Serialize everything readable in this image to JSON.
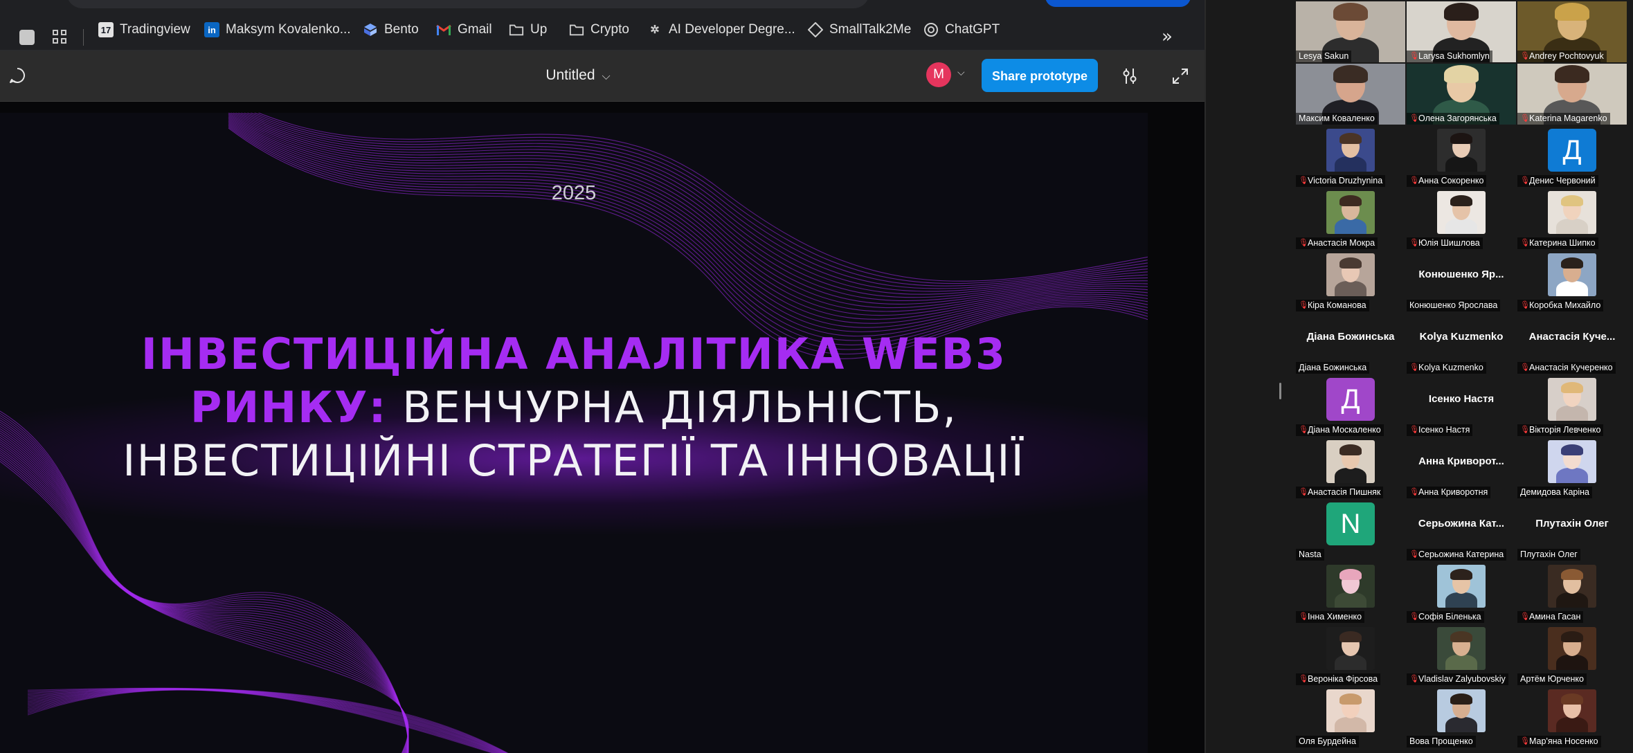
{
  "browser": {
    "bookmarks": [
      {
        "label": "Tradingview",
        "icon": "tradingview-icon"
      },
      {
        "label": "Maksym Kovalenko...",
        "icon": "linkedin-icon"
      },
      {
        "label": "Bento",
        "icon": "bento-icon"
      },
      {
        "label": "Gmail",
        "icon": "gmail-icon"
      },
      {
        "label": "Up",
        "icon": "folder-icon"
      },
      {
        "label": "Crypto",
        "icon": "folder-icon"
      },
      {
        "label": "AI Developer Degre...",
        "icon": "ai-developer-icon"
      },
      {
        "label": "SmallTalk2Me",
        "icon": "smalltalk-icon"
      },
      {
        "label": "ChatGPT",
        "icon": "chatgpt-icon"
      }
    ],
    "more_label": "»"
  },
  "figma": {
    "file_title": "Untitled",
    "avatar_initial": "M",
    "share_label": "Share prototype"
  },
  "slide": {
    "year": "2025",
    "title_highlight": "ІНВЕСТИЦІЙНА АНАЛІТИКА WEB3 РИНКУ:",
    "title_rest": " ВЕНЧУРНА ДІЯЛЬНІСТЬ, ІНВЕСТИЦІЙНІ СТРАТЕГІЇ ТА ІННОВАЦІЇ",
    "accent_color": "#a52cf2"
  },
  "gallery": {
    "participants": [
      {
        "name": "Lesya Sakun",
        "kind": "video",
        "muted": false,
        "bg": "#b9b2a8",
        "skin": "#d9b49a",
        "hair": "#6b4a36",
        "shirt": "#2d2d2d"
      },
      {
        "name": "Larysa Sukhomlyn",
        "kind": "video",
        "muted": true,
        "bg": "#d8d4cc",
        "skin": "#e0b9a0",
        "hair": "#2a1f1a",
        "shirt": "#222222"
      },
      {
        "name": "Andrey Pochtovyuk",
        "kind": "video",
        "muted": true,
        "bg": "#6d5a2a",
        "skin": "#d8b37a",
        "hair": "#caa24a",
        "shirt": "#3a2e14"
      },
      {
        "name": "Максим Коваленко",
        "kind": "video",
        "muted": false,
        "active": true,
        "bg": "#8c8f96",
        "skin": "#d6a58c",
        "hair": "#3a2c24",
        "shirt": "#1f1f25"
      },
      {
        "name": "Олена Загорянська",
        "kind": "video",
        "muted": true,
        "bg": "#18332e",
        "skin": "#e8c9a6",
        "hair": "#e3d3a4",
        "shirt": "#2f5a48"
      },
      {
        "name": "Katerina Magarenko",
        "kind": "video",
        "muted": true,
        "bg": "#cfc9bd",
        "skin": "#d7a98d",
        "hair": "#3b2a20",
        "shirt": "#585858"
      },
      {
        "name": "Victoria Druzhynina",
        "kind": "photo",
        "muted": true,
        "bg": "#3b4a8c",
        "skin": "#e4c0a3",
        "hair": "#4a3426",
        "shirt": "#24305e"
      },
      {
        "name": "Анна Сокоренко",
        "kind": "photo",
        "muted": true,
        "bg": "#2d2d2d",
        "skin": "#e8cbb5",
        "hair": "#1c1412",
        "shirt": "#161616"
      },
      {
        "name": "Денис Червоний",
        "kind": "letter",
        "muted": true,
        "letter": "Д",
        "color": "#0f7bd4"
      },
      {
        "name": "Анастасія Мокра",
        "kind": "photo",
        "muted": true,
        "bg": "#6c8d4e",
        "skin": "#d9b79c",
        "hair": "#3d2a20",
        "shirt": "#3a6aa6"
      },
      {
        "name": "Юлія Шишлова",
        "kind": "photo",
        "muted": true,
        "bg": "#ece7e2",
        "skin": "#e5c3a8",
        "hair": "#2b211b",
        "shirt": "#e6e6e6"
      },
      {
        "name": "Катерина Шипко",
        "kind": "photo",
        "muted": true,
        "bg": "#e7e1da",
        "skin": "#f0d3bd",
        "hair": "#e0c480",
        "shirt": "#d8d0c6"
      },
      {
        "name": "Кіра Команова",
        "kind": "photo",
        "muted": true,
        "bg": "#b7a59a",
        "skin": "#e8c8b5",
        "hair": "#4a3a32",
        "shirt": "#6b5e58"
      },
      {
        "name": "Конюшенко Ярослава",
        "kind": "name",
        "muted": false,
        "big": "Конюшенко  Яр..."
      },
      {
        "name": "Коробка Михайло",
        "kind": "photo",
        "muted": true,
        "bg": "#8da6c4",
        "skin": "#d8ae8f",
        "hair": "#2a211b",
        "shirt": "#ffffff"
      },
      {
        "name": "Діана Божинська",
        "kind": "name",
        "muted": false,
        "big": "Діана Божинська"
      },
      {
        "name": "Kolya Kuzmenko",
        "kind": "name",
        "muted": true,
        "big": "Kolya Kuzmenko"
      },
      {
        "name": "Анастасія Кучеренко",
        "kind": "name",
        "muted": true,
        "big": "Анастасія  Куче..."
      },
      {
        "name": "Діана Москаленко",
        "kind": "letter",
        "muted": true,
        "letter": "Д",
        "color": "#a047c9"
      },
      {
        "name": "Ісенко Настя",
        "kind": "name",
        "muted": true,
        "big": "Ісенко Настя"
      },
      {
        "name": "Вікторія Левченко",
        "kind": "photo",
        "muted": true,
        "bg": "#d7cfc9",
        "skin": "#f1d4c0",
        "hair": "#e0b878",
        "shirt": "#c4b6ad"
      },
      {
        "name": "Анастасія Пишняк",
        "kind": "photo",
        "muted": true,
        "bg": "#d9cfc2",
        "skin": "#e8c8ae",
        "hair": "#3b2b22",
        "shirt": "#1d1d1d"
      },
      {
        "name": "Анна Криворотня",
        "kind": "name",
        "muted": true,
        "big": "Анна  Криворот..."
      },
      {
        "name": "Демидова Каріна",
        "kind": "photo",
        "muted": false,
        "bg": "#cfd6ee",
        "skin": "#f3dccf",
        "hair": "#3a3f77",
        "shirt": "#6e77c2"
      },
      {
        "name": "Nasta",
        "kind": "letter",
        "muted": false,
        "letter": "N",
        "color": "#1fa67a"
      },
      {
        "name": "Серьожина Катерина",
        "kind": "name",
        "muted": true,
        "big": "Серьожина  Кат..."
      },
      {
        "name": "Плутахін Олег",
        "kind": "name",
        "muted": false,
        "big": "Плутахін Олег"
      },
      {
        "name": "Інна Хименко",
        "kind": "photo",
        "muted": true,
        "bg": "#2e3a2a",
        "skin": "#f0c8d4",
        "hair": "#e8a6bc",
        "shirt": "#3d4a36"
      },
      {
        "name": "Софія Біленька",
        "kind": "photo",
        "muted": true,
        "bg": "#9fc3d8",
        "skin": "#e6c4a6",
        "hair": "#2c221c",
        "shirt": "#2f4252"
      },
      {
        "name": "Амина Гасан",
        "kind": "photo",
        "muted": true,
        "bg": "#3a2b22",
        "skin": "#e2bfa0",
        "hair": "#8a5a34",
        "shirt": "#1f1712"
      },
      {
        "name": "Вероніка Фірсова",
        "kind": "photo",
        "muted": true,
        "bg": "#1d1d1d",
        "skin": "#e6c6b0",
        "hair": "#3a2a22",
        "shirt": "#2c2c2c"
      },
      {
        "name": "Vladislav Zalyubovskiy",
        "kind": "photo",
        "muted": true,
        "bg": "#3a4a3a",
        "skin": "#d8b090",
        "hair": "#4a3624",
        "shirt": "#5a6a4a"
      },
      {
        "name": "Артём Юрченко",
        "kind": "photo",
        "muted": false,
        "bg": "#4a2e1e",
        "skin": "#d8ae8e",
        "hair": "#2a1c14",
        "shirt": "#1e1410"
      },
      {
        "name": "Оля Бурдейна",
        "kind": "photo",
        "muted": false,
        "bg": "#e9d7cc",
        "skin": "#f2d0bc",
        "hair": "#c89a6c",
        "shirt": "#d2b8a8"
      },
      {
        "name": "Вова Прощенко",
        "kind": "photo",
        "muted": false,
        "bg": "#b8cbe0",
        "skin": "#d6ae90",
        "hair": "#2a1f18",
        "shirt": "#2a2a30"
      },
      {
        "name": "Мар'яна Носенко",
        "kind": "photo",
        "muted": true,
        "bg": "#5a2a22",
        "skin": "#e8c0a8",
        "hair": "#6a3a24",
        "shirt": "#3a1a14"
      }
    ]
  }
}
